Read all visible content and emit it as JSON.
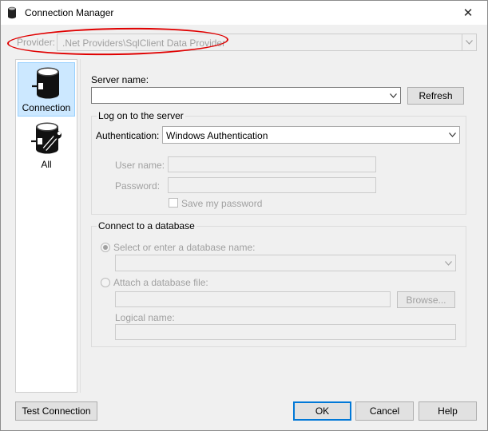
{
  "window": {
    "title": "Connection Manager",
    "close_glyph": "✕"
  },
  "provider": {
    "label": "Provider:",
    "value": ".Net Providers\\SqlClient Data Provider"
  },
  "nav": {
    "items": [
      {
        "label": "Connection",
        "icon": "database-connection-icon",
        "selected": true
      },
      {
        "label": "All",
        "icon": "database-settings-icon",
        "selected": false
      }
    ]
  },
  "server": {
    "label": "Server name:",
    "value": "",
    "refresh_label": "Refresh"
  },
  "logon": {
    "group_label": "Log on to the server",
    "auth_label": "Authentication:",
    "auth_value": "Windows Authentication",
    "username_label": "User name:",
    "username_value": "",
    "password_label": "Password:",
    "password_value": "",
    "save_password_label": "Save my password"
  },
  "database": {
    "group_label": "Connect to a database",
    "select_option_label": "Select or enter a database name:",
    "select_value": "",
    "attach_option_label": "Attach a database file:",
    "attach_value": "",
    "browse_label": "Browse...",
    "logical_name_label": "Logical name:",
    "logical_name_value": ""
  },
  "footer": {
    "test_label": "Test Connection",
    "ok_label": "OK",
    "cancel_label": "Cancel",
    "help_label": "Help"
  },
  "colors": {
    "annotation": "#e00000",
    "selected_nav": "#cce8ff",
    "disabled_text": "#a0a0a0"
  }
}
